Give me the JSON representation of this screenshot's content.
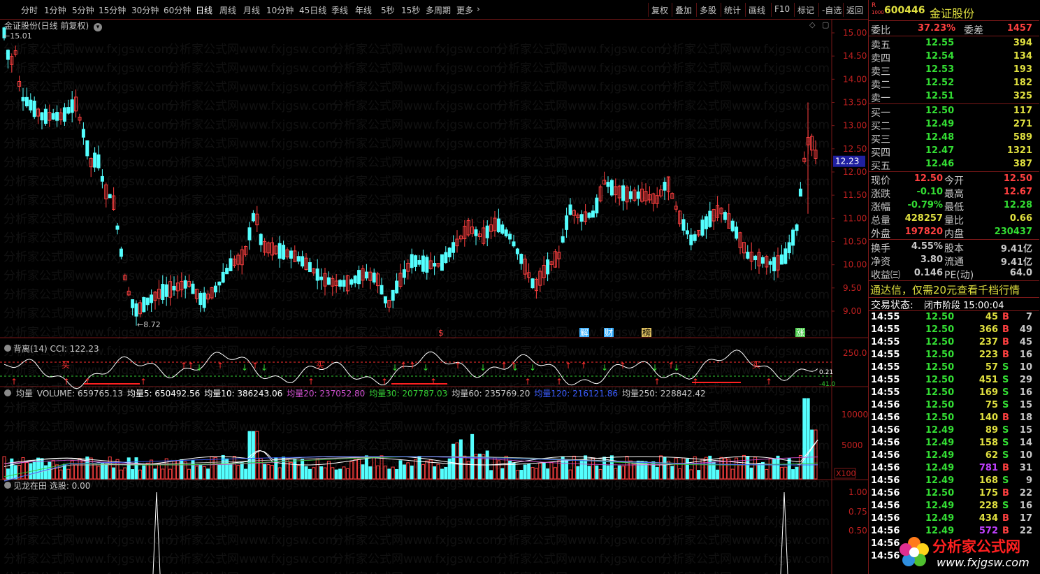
{
  "toolbar": {
    "periods": [
      "分时",
      "1分钟",
      "5分钟",
      "15分钟",
      "30分钟",
      "60分钟",
      "日线",
      "周线",
      "月线",
      "10分钟",
      "45日线",
      "季线",
      "年线",
      "5秒",
      "15秒",
      "多周期",
      "更多"
    ],
    "active_period": "日线",
    "tools": [
      "复权",
      "叠加",
      "多股",
      "统计",
      "画线",
      "F10",
      "标记",
      "-自选",
      "返回"
    ]
  },
  "stock": {
    "code": "600446",
    "name": "金证股份",
    "market_flag": "R",
    "market_flag2": "1000"
  },
  "main_chart": {
    "title": "金证股份(日线 前复权)",
    "high_label": "15.01",
    "low_label": "8.72",
    "current_price_tag": "12.23",
    "y_ticks": [
      "15.00",
      "14.50",
      "14.00",
      "13.50",
      "13.00",
      "12.50",
      "12.00",
      "11.50",
      "11.00",
      "10.50",
      "10.00",
      "9.50",
      "9.00"
    ],
    "event_markers": [
      "$",
      "解",
      "财",
      "榜",
      "涨"
    ],
    "watermark": "分析家公式网www.fxjgsw.com"
  },
  "cci_panel": {
    "title": "背离(14)  CCI: 122.23",
    "y_label": "250.0",
    "buy_label": "买",
    "value_label_1": "0.21",
    "value_label_2": "-41.0"
  },
  "volume_panel": {
    "title_items": [
      {
        "label": "均量",
        "color": "#c8c8c8"
      },
      {
        "label": "VOLUME: 659765.13",
        "color": "#c8c8c8"
      },
      {
        "label": "均量5: 650492.56",
        "color": "#ffffff"
      },
      {
        "label": "均量10: 386243.06",
        "color": "#ffffff"
      },
      {
        "label": "均量20: 237052.80",
        "color": "#d04fd0"
      },
      {
        "label": "均量30: 207787.03",
        "color": "#33cc33"
      },
      {
        "label": "均量60: 235769.20",
        "color": "#c8c8c8"
      },
      {
        "label": "均量120: 216121.86",
        "color": "#3a5cff"
      },
      {
        "label": "均量250: 228842.42",
        "color": "#c8c8c8"
      }
    ],
    "y_ticks": [
      "10000",
      "5000"
    ],
    "unit": "X100"
  },
  "signal_panel": {
    "title": "见龙在田  选股: 0.00",
    "y_ticks": [
      "1.00",
      "0.75",
      "0.50"
    ]
  },
  "quote": {
    "weibi": {
      "label": "委比",
      "value": "37.23%",
      "label2": "委差",
      "value2": "1457"
    },
    "asks": [
      {
        "label": "卖五",
        "price": "12.55",
        "vol": "394"
      },
      {
        "label": "卖四",
        "price": "12.54",
        "vol": "134"
      },
      {
        "label": "卖三",
        "price": "12.53",
        "vol": "193"
      },
      {
        "label": "卖二",
        "price": "12.52",
        "vol": "182"
      },
      {
        "label": "卖一",
        "price": "12.51",
        "vol": "325"
      }
    ],
    "bids": [
      {
        "label": "买一",
        "price": "12.50",
        "vol": "117"
      },
      {
        "label": "买二",
        "price": "12.49",
        "vol": "271"
      },
      {
        "label": "买三",
        "price": "12.48",
        "vol": "589"
      },
      {
        "label": "买四",
        "price": "12.47",
        "vol": "1321"
      },
      {
        "label": "买五",
        "price": "12.46",
        "vol": "387"
      }
    ],
    "stats": [
      {
        "l1": "现价",
        "v1": "12.50",
        "c1": "#ff4040",
        "l2": "今开",
        "v2": "12.50",
        "c2": "#ff4040"
      },
      {
        "l1": "涨跌",
        "v1": "-0.10",
        "c1": "#33dd33",
        "l2": "最高",
        "v2": "12.67",
        "c2": "#ff4040"
      },
      {
        "l1": "涨幅",
        "v1": "-0.79%",
        "c1": "#33dd33",
        "l2": "最低",
        "v2": "12.28",
        "c2": "#33dd33"
      },
      {
        "l1": "总量",
        "v1": "428257",
        "c1": "#e0e040",
        "l2": "量比",
        "v2": "0.66",
        "c2": "#e0e040"
      },
      {
        "l1": "外盘",
        "v1": "197820",
        "c1": "#ff4040",
        "l2": "内盘",
        "v2": "230437",
        "c2": "#33dd33"
      }
    ],
    "stats2": [
      {
        "l1": "换手",
        "v1": "4.55%",
        "l2": "股本",
        "v2": "9.41亿"
      },
      {
        "l1": "净资",
        "v1": "3.80",
        "l2": "流通",
        "v2": "9.41亿"
      },
      {
        "l1": "收益㈢",
        "v1": "0.146",
        "l2": "PE(动)",
        "v2": "64.0"
      }
    ],
    "promo": "通达信，仅需20元查看千档行情",
    "trade_status_label": "交易状态:",
    "trade_status": "闭市阶段 15:00:04",
    "ticks": [
      {
        "t": "14:55",
        "p": "12.50",
        "v": "45",
        "d": "B",
        "n": "7"
      },
      {
        "t": "14:55",
        "p": "12.50",
        "v": "366",
        "d": "B",
        "n": "49"
      },
      {
        "t": "14:55",
        "p": "12.50",
        "v": "237",
        "d": "B",
        "n": "45"
      },
      {
        "t": "14:55",
        "p": "12.50",
        "v": "223",
        "d": "B",
        "n": "16"
      },
      {
        "t": "14:55",
        "p": "12.50",
        "v": "57",
        "d": "S",
        "n": "10"
      },
      {
        "t": "14:55",
        "p": "12.50",
        "v": "451",
        "d": "S",
        "n": "29"
      },
      {
        "t": "14:55",
        "p": "12.50",
        "v": "169",
        "d": "S",
        "n": "16"
      },
      {
        "t": "14:56",
        "p": "12.50",
        "v": "75",
        "d": "S",
        "n": "15"
      },
      {
        "t": "14:56",
        "p": "12.50",
        "v": "140",
        "d": "B",
        "n": "18"
      },
      {
        "t": "14:56",
        "p": "12.49",
        "v": "89",
        "d": "S",
        "n": "15"
      },
      {
        "t": "14:56",
        "p": "12.49",
        "v": "158",
        "d": "S",
        "n": "14"
      },
      {
        "t": "14:56",
        "p": "12.49",
        "v": "62",
        "d": "S",
        "n": "10"
      },
      {
        "t": "14:56",
        "p": "12.49",
        "v": "781",
        "d": "B",
        "n": "31"
      },
      {
        "t": "14:56",
        "p": "12.49",
        "v": "168",
        "d": "S",
        "n": "9"
      },
      {
        "t": "14:56",
        "p": "12.50",
        "v": "175",
        "d": "B",
        "n": "22"
      },
      {
        "t": "14:56",
        "p": "12.49",
        "v": "228",
        "d": "S",
        "n": "16"
      },
      {
        "t": "14:56",
        "p": "12.49",
        "v": "434",
        "d": "B",
        "n": "17"
      },
      {
        "t": "14:56",
        "p": "12.49",
        "v": "572",
        "d": "B",
        "n": "22"
      },
      {
        "t": "14:56",
        "p": "",
        "v": "",
        "d": "",
        "n": ""
      },
      {
        "t": "14:56",
        "p": "",
        "v": "",
        "d": "",
        "n": ""
      }
    ]
  },
  "logo": {
    "title": "分析家公式网",
    "url": "www.fxjgsw.com"
  }
}
